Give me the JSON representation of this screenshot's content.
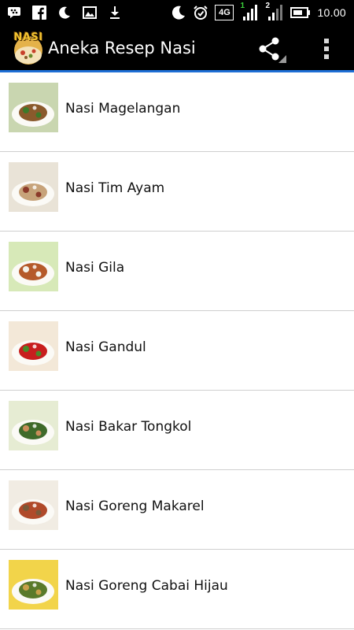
{
  "status_bar": {
    "time": "10.00",
    "network_label": "4G",
    "sim1_label": "1",
    "sim2_label": "2",
    "left_icons": [
      "bbm-icon",
      "facebook-icon",
      "moon-icon",
      "image-icon",
      "download-icon"
    ],
    "right_icons": [
      "moon-icon",
      "alarm-icon",
      "network-4g-icon",
      "signal-sim1-icon",
      "signal-sim2-icon",
      "battery-icon"
    ]
  },
  "action_bar": {
    "logo_text": "NASI",
    "title": "Aneka Resep Nasi",
    "share_icon": "share-icon",
    "overflow_icon": "overflow-menu-icon",
    "accent_color": "#1e6fd6"
  },
  "recipes": [
    {
      "name": "Nasi Magelangan",
      "thumb_colors": [
        "#c9d6b0",
        "#8a5a2c",
        "#3d7a2a"
      ]
    },
    {
      "name": "Nasi Tim Ayam",
      "thumb_colors": [
        "#e9e3d7",
        "#c7a37a",
        "#8b3a2a"
      ]
    },
    {
      "name": "Nasi Gila",
      "thumb_colors": [
        "#d7e9b8",
        "#b55a2a",
        "#f4f1e8"
      ]
    },
    {
      "name": "Nasi Gandul",
      "thumb_colors": [
        "#f3e8d8",
        "#c81e1e",
        "#4a8a2a"
      ]
    },
    {
      "name": "Nasi Bakar Tongkol",
      "thumb_colors": [
        "#e6ecd3",
        "#3f6a2a",
        "#c98d5a"
      ]
    },
    {
      "name": "Nasi Goreng Makarel",
      "thumb_colors": [
        "#f1ece3",
        "#b04a2a",
        "#7a5a3a"
      ]
    },
    {
      "name": "Nasi Goreng Cabai Hijau",
      "thumb_colors": [
        "#f2d44a",
        "#5a7a2a",
        "#c8a04a"
      ]
    }
  ]
}
